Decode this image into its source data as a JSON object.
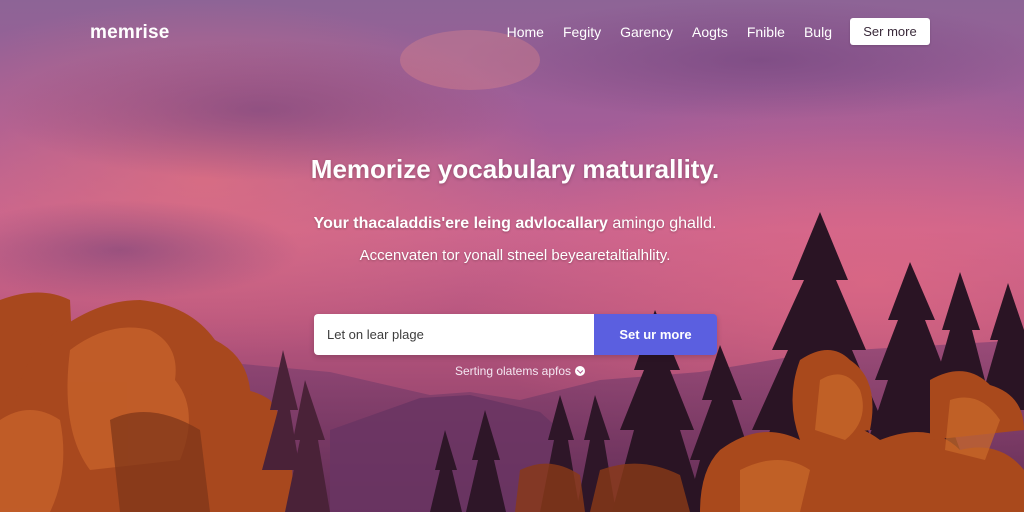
{
  "brand": {
    "logo_text": "memrise"
  },
  "nav": {
    "links": [
      {
        "label": "Home"
      },
      {
        "label": "Fegity"
      },
      {
        "label": "Garency"
      },
      {
        "label": "Aogts"
      },
      {
        "label": "Fnible"
      },
      {
        "label": "Bulg"
      }
    ],
    "cta_label": "Ser more"
  },
  "hero": {
    "headline": "Memorize yocabulary maturallity.",
    "subline1_bold": "Your thacaladdis'ere leing advlocallary",
    "subline1_rest": " amingo ghalld.",
    "subline2": "Accenvaten tor yonall stneel beyearetaltialhlity."
  },
  "signup": {
    "input_placeholder": "Let on lear plage",
    "button_label": "Set ur more"
  },
  "hint": {
    "text": "Serting olatems apfos",
    "icon": "check-circle-icon"
  },
  "colors": {
    "accent": "#5b5fe0",
    "sky_top": "#8a5a8f",
    "sky_mid": "#c8608f",
    "foliage_orange": "#b8541e",
    "pine_dark": "#2a1420"
  }
}
